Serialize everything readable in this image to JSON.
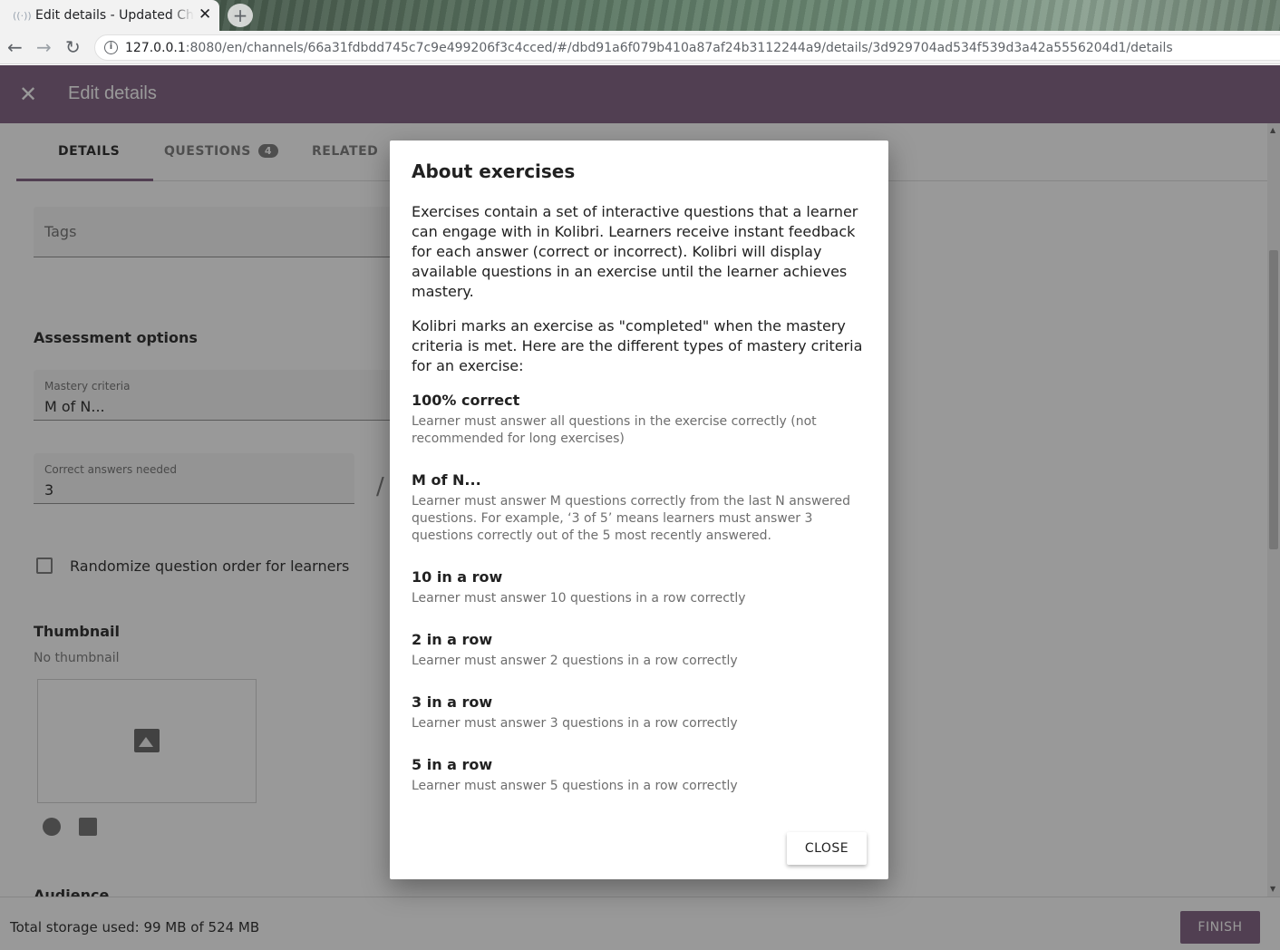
{
  "browser": {
    "tab_title": "Edit details - Updated Cha",
    "tab_close": "✕",
    "new_tab": "+",
    "url_host": "127.0.0.1",
    "url_rest": ":8080/en/channels/66a31fdbdd745c7c9e499206f3c4cced/#/dbd91a6f079b410a87af24b3112244a9/details/3d929704ad534f539d3a42a5556204d1/details"
  },
  "appbar": {
    "close": "✕",
    "title": "Edit details"
  },
  "tabs": {
    "details": "DETAILS",
    "questions": "QUESTIONS",
    "questions_count": "4",
    "related": "RELATED"
  },
  "form": {
    "tags_label": "Tags",
    "assessment_heading": "Assessment options",
    "mastery_label": "Mastery criteria",
    "mastery_value": "M of N...",
    "correct_label": "Correct answers needed",
    "correct_value": "3",
    "slash": "/",
    "randomize_label": "Randomize question order for learners",
    "thumbnail_heading": "Thumbnail",
    "no_thumbnail": "No thumbnail",
    "audience_heading": "Audience"
  },
  "footer": {
    "storage": "Total storage used: 99 MB of 524 MB",
    "finish": "FINISH"
  },
  "dialog": {
    "title": "About exercises",
    "para1": "Exercises contain a set of interactive questions that a learner can engage with in Kolibri. Learners receive instant feedback for each answer (correct or incorrect). Kolibri will display available questions in an exercise until the learner achieves mastery.",
    "para2": "Kolibri marks an exercise as \"completed\" when the mastery criteria is met. Here are the different types of mastery criteria for an exercise:",
    "criteria": [
      {
        "name": "100% correct",
        "desc": "Learner must answer all questions in the exercise correctly (not recommended for long exercises)"
      },
      {
        "name": "M of N...",
        "desc": "Learner must answer M questions correctly from the last N answered questions. For example, ‘3 of 5’ means learners must answer 3 questions correctly out of the 5 most recently answered."
      },
      {
        "name": "10 in a row",
        "desc": "Learner must answer 10 questions in a row correctly"
      },
      {
        "name": "2 in a row",
        "desc": "Learner must answer 2 questions in a row correctly"
      },
      {
        "name": "3 in a row",
        "desc": "Learner must answer 3 questions in a row correctly"
      },
      {
        "name": "5 in a row",
        "desc": "Learner must answer 5 questions in a row correctly"
      }
    ],
    "close": "CLOSE"
  },
  "colors": {
    "brand": "#7b5a7d",
    "overlay": "rgba(33,33,33,0.46)"
  },
  "icons": [
    "favicon-icon",
    "back-arrow-icon",
    "forward-arrow-icon",
    "reload-icon",
    "info-icon",
    "close-icon",
    "image-placeholder-icon",
    "camera-icon",
    "gallery-icon"
  ]
}
